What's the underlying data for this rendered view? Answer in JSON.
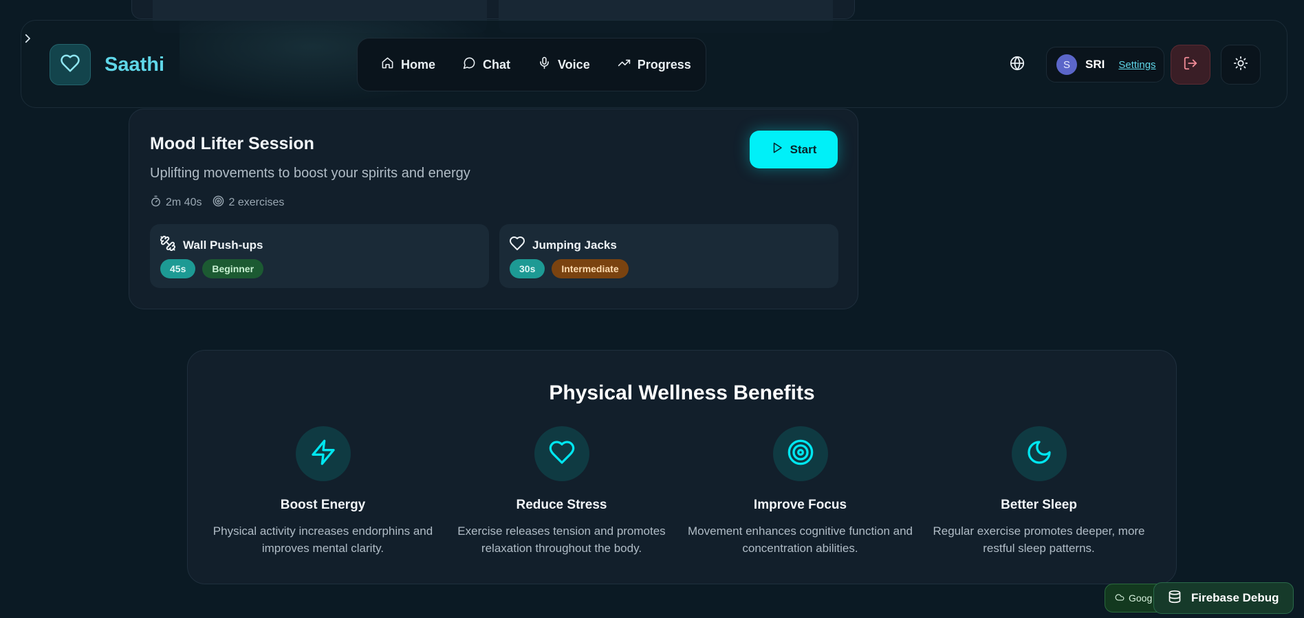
{
  "header": {
    "app_name": "Saathi",
    "nav": [
      {
        "label": "Home",
        "icon": "home-icon"
      },
      {
        "label": "Chat",
        "icon": "chat-icon"
      },
      {
        "label": "Voice",
        "icon": "mic-icon"
      },
      {
        "label": "Progress",
        "icon": "trending-up-icon"
      }
    ],
    "user": {
      "initial": "S",
      "name": "SRI",
      "settings_label": "Settings"
    }
  },
  "session": {
    "title": "Mood Lifter Session",
    "subtitle": "Uplifting movements to boost your spirits and energy",
    "duration": "2m 40s",
    "exercises_count": "2 exercises",
    "start_label": "Start",
    "exercises": [
      {
        "name": "Wall Push-ups",
        "duration": "45s",
        "level": "Beginner",
        "icon": "dumbbell-icon"
      },
      {
        "name": "Jumping Jacks",
        "duration": "30s",
        "level": "Intermediate",
        "icon": "heart-icon"
      }
    ]
  },
  "benefits": {
    "title": "Physical Wellness Benefits",
    "items": [
      {
        "title": "Boost Energy",
        "desc": "Physical activity increases endorphins and improves mental clarity.",
        "icon": "lightning-icon"
      },
      {
        "title": "Reduce Stress",
        "desc": "Exercise releases tension and promotes relaxation throughout the body.",
        "icon": "heart-icon"
      },
      {
        "title": "Improve Focus",
        "desc": "Movement enhances cognitive function and concentration abilities.",
        "icon": "target-icon"
      },
      {
        "title": "Better Sleep",
        "desc": "Regular exercise promotes deeper, more restful sleep patterns.",
        "icon": "moon-icon"
      }
    ]
  },
  "footer": {
    "google_label": "Goog",
    "firebase_label": "Firebase Debug"
  },
  "colors": {
    "accent": "#00f0f8",
    "background": "#0b1a24",
    "card": "#121f2b"
  }
}
